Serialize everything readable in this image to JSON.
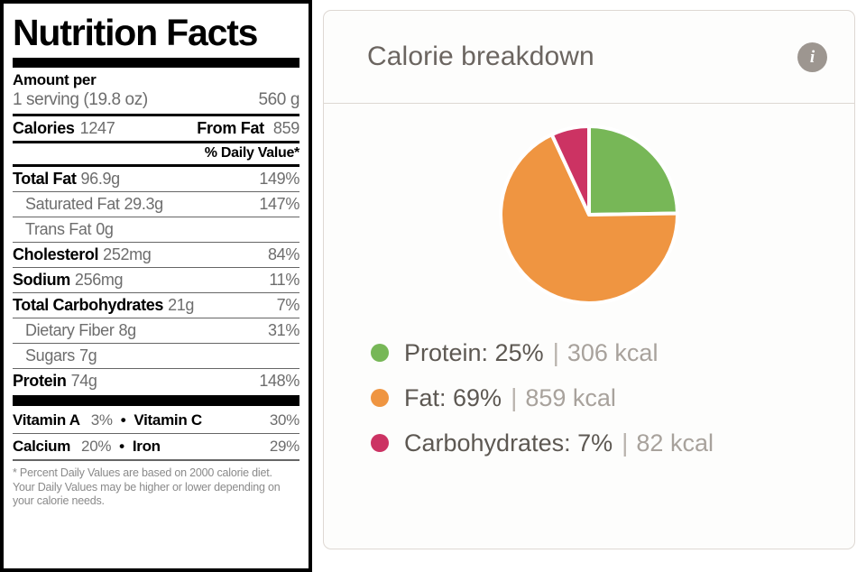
{
  "nutrition_label": {
    "title": "Nutrition Facts",
    "amount_per_label": "Amount per",
    "serving_description": "1 serving (19.8 oz)",
    "serving_weight": "560 g",
    "calories_label": "Calories",
    "calories_value": "1247",
    "from_fat_label": "From Fat",
    "from_fat_value": "859",
    "daily_value_header": "% Daily Value*",
    "rows": [
      {
        "name": "Total Fat",
        "amount": "96.9g",
        "percent": "149%",
        "bold": true,
        "indent": false
      },
      {
        "name": "Saturated Fat",
        "amount": "29.3g",
        "percent": "147%",
        "bold": false,
        "indent": true
      },
      {
        "name": "Trans Fat",
        "amount": "0g",
        "percent": "",
        "bold": false,
        "indent": true
      },
      {
        "name": "Cholesterol",
        "amount": "252mg",
        "percent": "84%",
        "bold": true,
        "indent": false
      },
      {
        "name": "Sodium",
        "amount": "256mg",
        "percent": "11%",
        "bold": true,
        "indent": false
      },
      {
        "name": "Total Carbohydrates",
        "amount": "21g",
        "percent": "7%",
        "bold": true,
        "indent": false
      },
      {
        "name": "Dietary Fiber",
        "amount": "8g",
        "percent": "31%",
        "bold": false,
        "indent": true
      },
      {
        "name": "Sugars",
        "amount": "7g",
        "percent": "",
        "bold": false,
        "indent": true
      },
      {
        "name": "Protein",
        "amount": "74g",
        "percent": "148%",
        "bold": true,
        "indent": false
      }
    ],
    "micronutrients": [
      {
        "left_name": "Vitamin A",
        "left_percent": "3%",
        "right_name": "Vitamin C",
        "right_percent": "30%"
      },
      {
        "left_name": "Calcium",
        "left_percent": "20%",
        "right_name": "Iron",
        "right_percent": "29%"
      }
    ],
    "separator": "•",
    "footnote": "* Percent Daily Values are based on 2000 calorie diet. Your Daily Values may be higher or lower depending on your calorie needs."
  },
  "breakdown_card": {
    "title": "Calorie breakdown",
    "info_icon_glyph": "i",
    "info_icon_name": "info-icon"
  },
  "chart_data": {
    "type": "pie",
    "title": "Calorie breakdown",
    "unit": "kcal",
    "total_kcal": 1247,
    "legend_position": "bottom-left",
    "start_angle_deg": 0,
    "direction": "clockwise",
    "labels": [
      "Protein",
      "Fat",
      "Carbohydrates"
    ],
    "values": [
      25,
      69,
      7
    ],
    "kcal": [
      306,
      859,
      82
    ],
    "colors": [
      "#77b757",
      "#ef9541",
      "#cc3363"
    ],
    "slices": [
      {
        "label": "Protein",
        "percent": 25,
        "percent_text": "25%",
        "kcal": 306,
        "kcal_text": "306 kcal",
        "color": "#77b757",
        "legend_text": "Protein: 25%"
      },
      {
        "label": "Fat",
        "percent": 69,
        "percent_text": "69%",
        "kcal": 859,
        "kcal_text": "859 kcal",
        "color": "#ef9541",
        "legend_text": "Fat: 69%"
      },
      {
        "label": "Carbohydrates",
        "percent": 7,
        "percent_text": "7%",
        "kcal": 82,
        "kcal_text": "82 kcal",
        "color": "#cc3363",
        "legend_text": "Carbohydrates: 7%"
      }
    ],
    "legend_separator": "|"
  }
}
